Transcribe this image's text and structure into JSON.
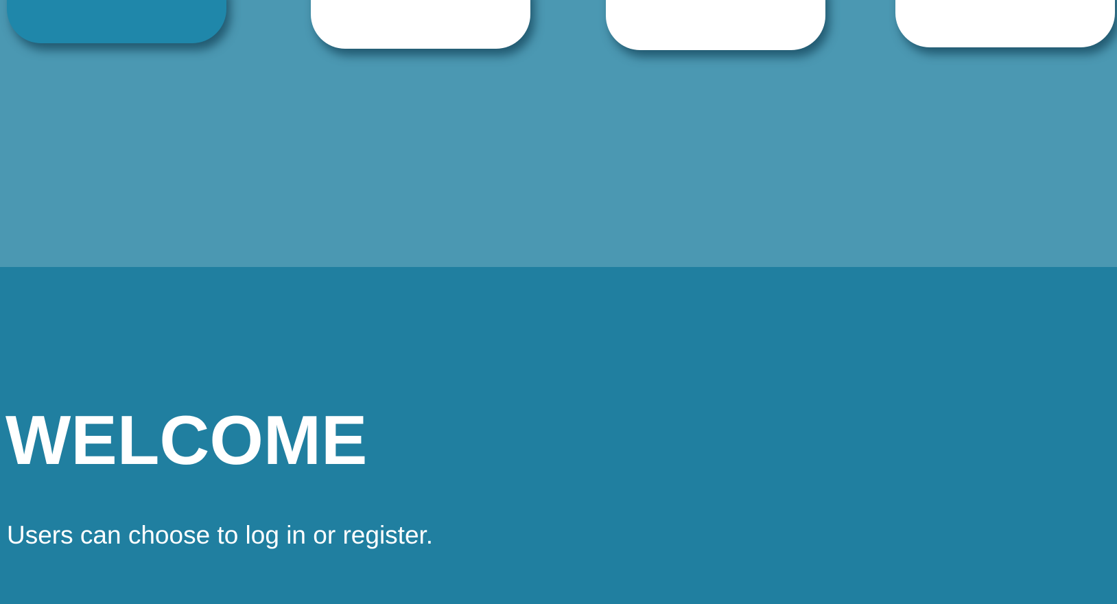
{
  "colors": {
    "top_band": "#4b98b2",
    "bottom_band": "#207fa0",
    "card": "#ffffff",
    "card_active": "#1f87aa",
    "text": "#ffffff"
  },
  "nav": {
    "cards": [
      {
        "label": "",
        "active": true
      },
      {
        "label": "",
        "active": false
      },
      {
        "label": "",
        "active": false
      },
      {
        "label": "",
        "active": false
      }
    ]
  },
  "hero": {
    "title": "WELCOME",
    "subtitle": "Users can choose to log in or register."
  }
}
